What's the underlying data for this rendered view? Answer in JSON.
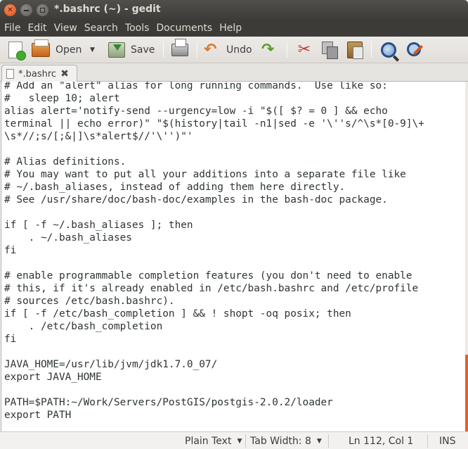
{
  "window": {
    "title": "*.bashrc (~) - gedit"
  },
  "menu": [
    "File",
    "Edit",
    "View",
    "Search",
    "Tools",
    "Documents",
    "Help"
  ],
  "toolbar": {
    "open_label": "Open",
    "save_label": "Save",
    "undo_label": "Undo",
    "icons": [
      "new-document-icon",
      "open-folder-icon",
      "save-icon",
      "print-icon",
      "undo-icon",
      "redo-icon",
      "cut-icon",
      "copy-icon",
      "paste-icon",
      "find-icon",
      "replace-icon"
    ]
  },
  "tab": {
    "label": "*.bashrc"
  },
  "editor": {
    "lines": [
      "# Add an \"alert\" alias for long running commands.  Use like so:",
      "#   sleep 10; alert",
      "alias alert='notify-send --urgency=low -i \"$([ $? = 0 ] && echo",
      "terminal || echo error)\" \"$(history|tail -n1|sed -e '\\''s/^\\s*[0-9]\\+",
      "\\s*//;s/[;&|]\\s*alert$//'\\'')\"'",
      "",
      "# Alias definitions.",
      "# You may want to put all your additions into a separate file like",
      "# ~/.bash_aliases, instead of adding them here directly.",
      "# See /usr/share/doc/bash-doc/examples in the bash-doc package.",
      "",
      "if [ -f ~/.bash_aliases ]; then",
      "    . ~/.bash_aliases",
      "fi",
      "",
      "# enable programmable completion features (you don't need to enable",
      "# this, if it's already enabled in /etc/bash.bashrc and /etc/profile",
      "# sources /etc/bash.bashrc).",
      "if [ -f /etc/bash_completion ] && ! shopt -oq posix; then",
      "    . /etc/bash_completion",
      "fi",
      "",
      "JAVA_HOME=/usr/lib/jvm/jdk1.7.0_07/",
      "export JAVA_HOME",
      "",
      "PATH=$PATH:~/Work/Servers/PostGIS/postgis-2.0.2/loader",
      "export PATH"
    ]
  },
  "status": {
    "language": "Plain Text",
    "tab_width": "Tab Width: 8",
    "position": "Ln 112, Col 1",
    "mode": "INS"
  },
  "colors": {
    "scroll_accent": "#e0622d",
    "titlebar": "#3c3b37"
  }
}
